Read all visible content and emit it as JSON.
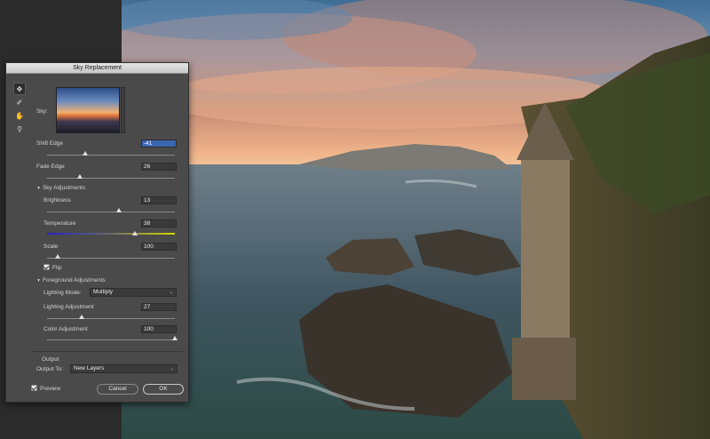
{
  "dialog": {
    "title": "Sky Replacement",
    "sky_label": "Sky:",
    "shift_edge": {
      "label": "Shift Edge",
      "value": "-41",
      "level": 0.3
    },
    "fade_edge": {
      "label": "Fade Edge",
      "value": "26",
      "level": 0.26
    },
    "sky_adjustments": {
      "title": "Sky Adjustments",
      "brightness": {
        "label": "Brightness",
        "value": "13",
        "level": 0.56
      },
      "temperature": {
        "label": "Temperature",
        "value": "38",
        "level": 0.69
      },
      "scale": {
        "label": "Scale",
        "value": "100",
        "level": 0.08
      },
      "flip_label": "Flip"
    },
    "foreground_adjustments": {
      "title": "Foreground Adjustments",
      "lighting_mode_label": "Lighting Mode:",
      "lighting_mode_value": "Multiply",
      "lighting_adjustment": {
        "label": "Lighting Adjustment",
        "value": "27",
        "level": 0.27
      },
      "color_adjustment": {
        "label": "Color Adjustment",
        "value": "100",
        "level": 1.0
      }
    },
    "output": {
      "title": "Output",
      "output_to_label": "Output To:",
      "output_to_value": "New Layers"
    },
    "preview_label": "Preview",
    "cancel_label": "Cancel",
    "ok_label": "OK"
  },
  "icons": {
    "tools": [
      "move-icon",
      "sky-brush-icon",
      "hand-icon",
      "zoom-icon"
    ]
  },
  "colors": {
    "selected_field": "#3b66b0",
    "dialog_bg": "#4a4a4a"
  }
}
